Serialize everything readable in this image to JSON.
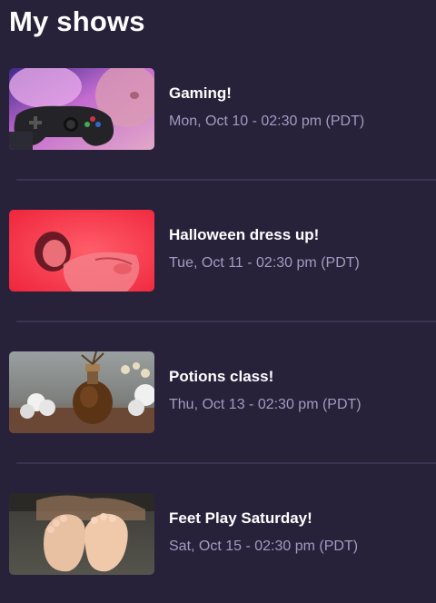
{
  "page": {
    "title": "My shows"
  },
  "shows": [
    {
      "title": "Gaming!",
      "time": "Mon, Oct 10 - 02:30 pm (PDT)",
      "thumbnail": "gamer-with-controller"
    },
    {
      "title": "Halloween dress up!",
      "time": "Tue, Oct 11 - 02:30 pm (PDT)",
      "thumbnail": "red-tinted-portrait"
    },
    {
      "title": "Potions class!",
      "time": "Thu, Oct 13 - 02:30 pm (PDT)",
      "thumbnail": "potion-bottle"
    },
    {
      "title": "Feet Play Saturday!",
      "time": "Sat, Oct 15 - 02:30 pm (PDT)",
      "thumbnail": "feet-on-couch"
    }
  ],
  "colors": {
    "background": "#27213a",
    "title_text": "#ffffff",
    "time_text": "#a29cc0",
    "divider": "#3a3352"
  }
}
